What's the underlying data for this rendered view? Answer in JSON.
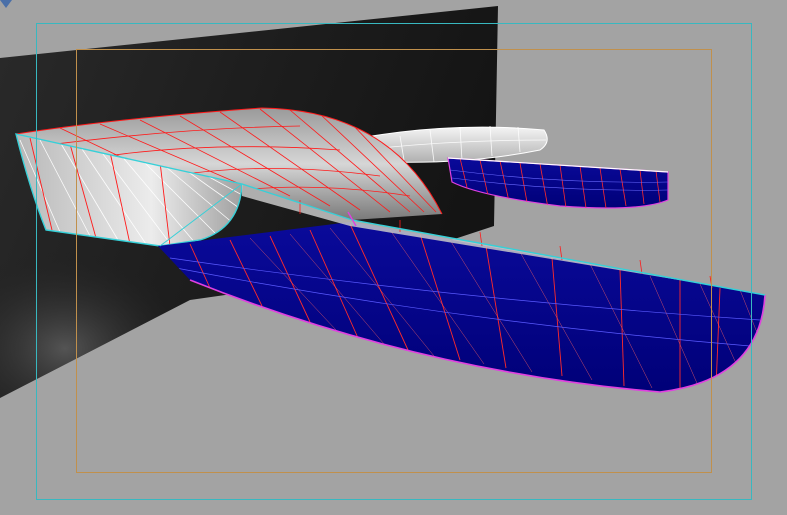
{
  "viewport": {
    "background": "#a3a3a3",
    "backdrop_panel_color": "#202020",
    "safe_frame_outer_color": "#38b8c0",
    "safe_frame_inner_color": "#c0904c",
    "hull_mesh_color": "#ff1a1a",
    "edge_highlight_color": "#36d0d8",
    "waterline_color": "#e040e0",
    "upper_surface_color": "#d8d8d8",
    "lower_surface_color": "#00008c",
    "corner_marker_icon": "triangle-marker-icon"
  }
}
